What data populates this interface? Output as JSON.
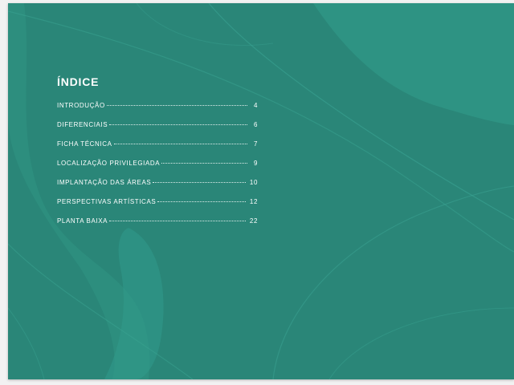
{
  "document": {
    "title": "ÍNDICE",
    "entries": [
      {
        "label": "INTRODUÇÃO",
        "page": "4"
      },
      {
        "label": "DIFERENCIAIS",
        "page": "6"
      },
      {
        "label": "FICHA TÉCNICA",
        "page": "7"
      },
      {
        "label": "LOCALIZAÇÃO PRIVILEGIADA",
        "page": "9"
      },
      {
        "label": "IMPLANTAÇÃO DAS ÁREAS",
        "page": "10"
      },
      {
        "label": "PERSPECTIVAS ARTÍSTICAS",
        "page": "12"
      },
      {
        "label": "PLANTA BAIXA",
        "page": "22"
      }
    ]
  },
  "colors": {
    "background": "#2a8678",
    "accent_shape": "#2f9584",
    "text": "#ffffff"
  }
}
